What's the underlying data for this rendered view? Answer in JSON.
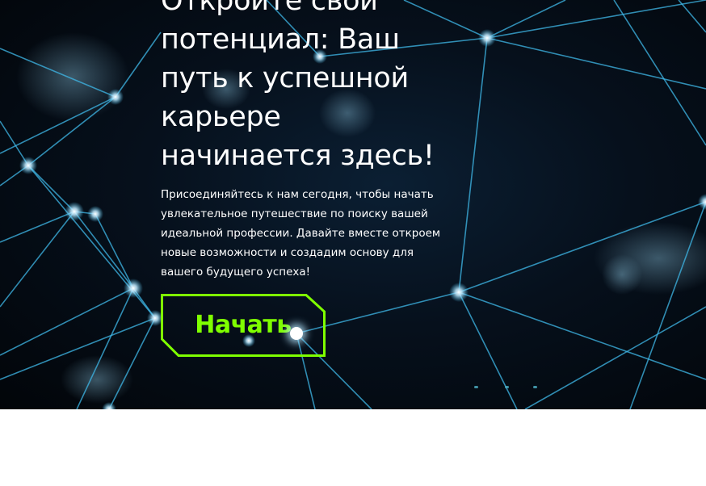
{
  "hero": {
    "headline": "Откройте свой потенциал: Ваш путь к успешной карьере начинается здесь!",
    "description": "Присоединяйтесь к нам сегодня, чтобы начать увлекательное путешествие по поиску вашей идеальной профессии. Давайте вместе откроем новые возможности и создадим основу для вашего будущего успеха!",
    "cta_label": "Начать",
    "background_image": "glowing-network-nodes",
    "slider_dot_count": 3
  },
  "colors": {
    "accent": "#7fff00",
    "headline_text": "#ffffff",
    "hero_background": "#020509",
    "network_line": "#3fb8e8",
    "page_background": "#ffffff"
  }
}
